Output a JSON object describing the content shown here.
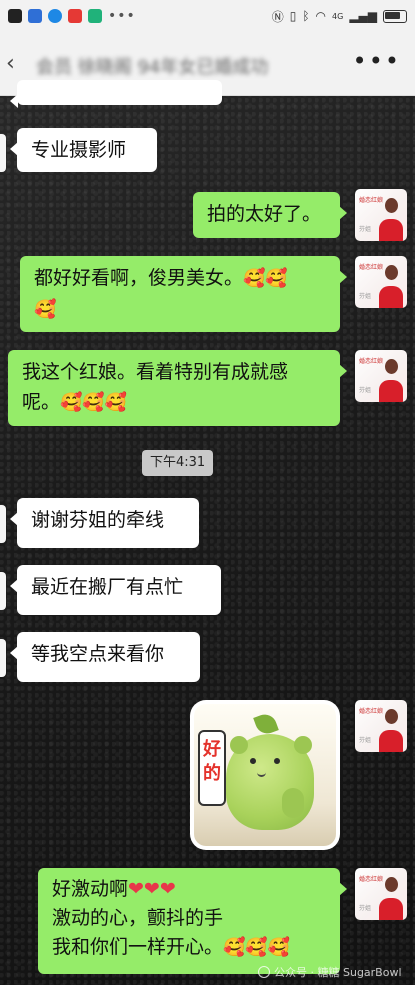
{
  "statusbar": {
    "left_icons": [
      "wechat-icon",
      "notes-icon",
      "browser-icon",
      "red-app-icon",
      "shield-app-icon"
    ],
    "right_icons": [
      "nfc-icon",
      "vibrate-icon",
      "bluetooth-icon",
      "wifi-icon",
      "signal-icon",
      "battery-icon"
    ],
    "network": "4G"
  },
  "header": {
    "title": "会员 徐晓阁 94年女已婚成功",
    "more": "•••"
  },
  "messages": [
    {
      "side": "in",
      "text": "专业摄影师"
    },
    {
      "side": "out",
      "text": "拍的太好了。"
    },
    {
      "side": "out",
      "line1": "都好好看啊，俊男美女。",
      "emoji1": "🥰🥰",
      "line2": "",
      "emoji2": "🥰"
    },
    {
      "side": "out",
      "line1": "我这个红娘。看着特别有成就感",
      "line2": "呢。",
      "emoji2": "🥰🥰🥰"
    },
    {
      "side": "in",
      "text": "谢谢芬姐的牵线"
    },
    {
      "side": "in",
      "text": "最近在搬厂有点忙"
    },
    {
      "side": "in",
      "text": "等我空点来看你"
    },
    {
      "side": "out",
      "type": "sticker",
      "sign": "好的"
    },
    {
      "side": "out",
      "line1": "好激动啊",
      "hearts": "❤❤❤",
      "line2": "激动的心，颤抖的手",
      "line3": "我和你们一样开心。",
      "emoji3": "🥰🥰🥰"
    }
  ],
  "time_label": "下午4:31",
  "avatar": {
    "text": "婚恋红娘",
    "name": "芬姐"
  },
  "watermark": {
    "label": "公众号 · 糖糖 SugarBowl"
  },
  "colors": {
    "out_bubble": "#95ec69",
    "in_bubble": "#ffffff",
    "header_bg": "#f2f2f2"
  }
}
